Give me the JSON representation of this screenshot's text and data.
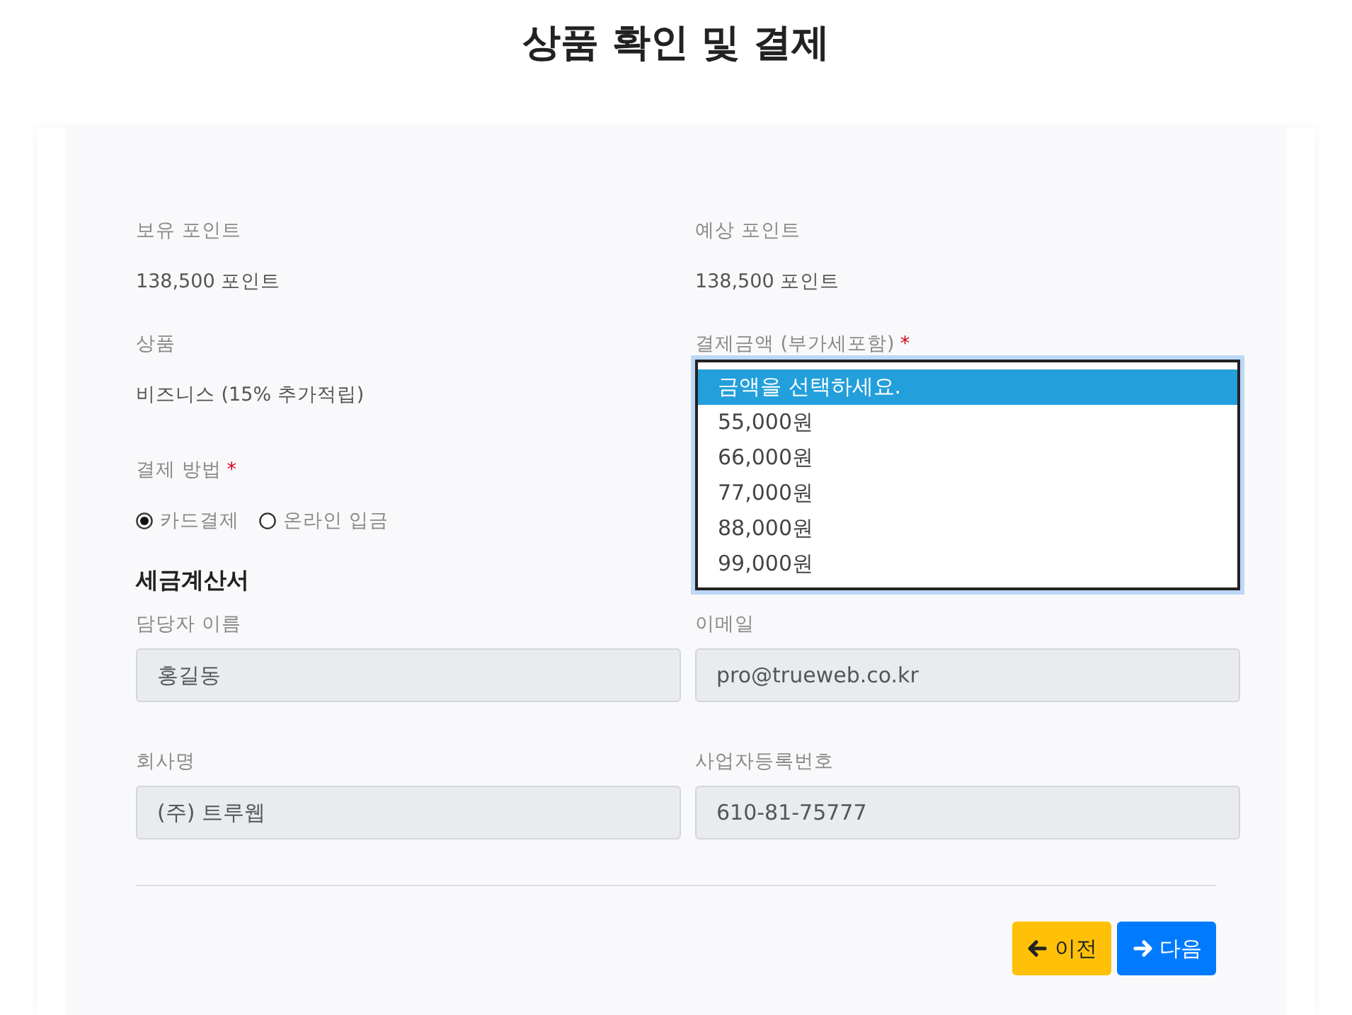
{
  "title": "상품 확인 및 결제",
  "summary": [
    {
      "label": "보유 포인트",
      "value": "138,500 포인트"
    },
    {
      "label": "예상 포인트",
      "value": "138,500 포인트"
    }
  ],
  "product": {
    "label": "상품",
    "value": "비즈니스 (15% 추가적립)"
  },
  "amount": {
    "label": "결제금액 (부가세포함)",
    "required_mark": "*",
    "options": [
      {
        "text": "금액을 선택하세요.",
        "selected": true
      },
      {
        "text": "55,000원",
        "selected": false
      },
      {
        "text": "66,000원",
        "selected": false
      },
      {
        "text": "77,000원",
        "selected": false
      },
      {
        "text": "88,000원",
        "selected": false
      },
      {
        "text": "99,000원",
        "selected": false
      }
    ]
  },
  "payment_method": {
    "label": "결제 방법",
    "required_mark": "*",
    "options": [
      {
        "label": "카드결제",
        "selected": true
      },
      {
        "label": "온라인 입금",
        "selected": false
      }
    ]
  },
  "tax_invoice": {
    "heading": "세금계산서",
    "fields": [
      {
        "label": "담당자 이름",
        "value": "홍길동"
      },
      {
        "label": "이메일",
        "value": "pro@trueweb.co.kr"
      },
      {
        "label": "회사명",
        "value": "(주) 트루웹"
      },
      {
        "label": "사업자등록번호",
        "value": "610-81-75777"
      }
    ]
  },
  "buttons": [
    {
      "label": "이전",
      "kind": "prev"
    },
    {
      "label": "다음",
      "kind": "next"
    }
  ]
}
